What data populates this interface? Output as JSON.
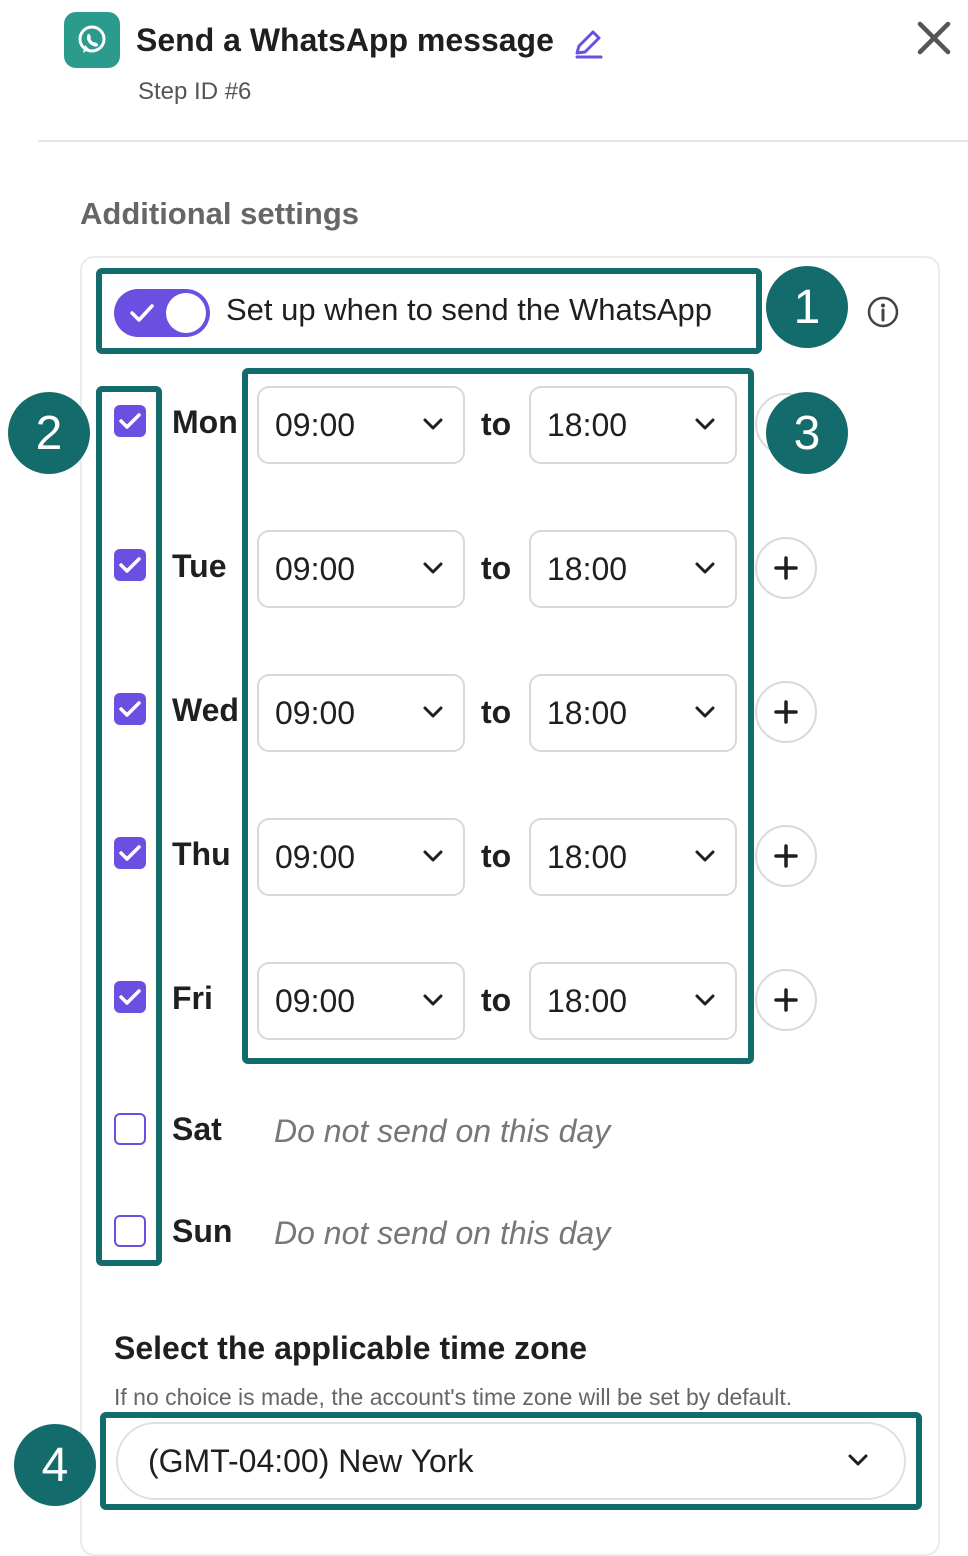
{
  "header": {
    "title": "Send a WhatsApp message",
    "step_id": "Step ID #6",
    "icons": {
      "app": "whatsapp-icon",
      "edit": "pencil-icon",
      "close": "close-icon"
    }
  },
  "section_title": "Additional settings",
  "toggle": {
    "label": "Set up when to send the WhatsApp",
    "enabled": true
  },
  "connector": "to",
  "days": [
    {
      "label": "Mon",
      "checked": true,
      "from": "09:00",
      "to": "18:00"
    },
    {
      "label": "Tue",
      "checked": true,
      "from": "09:00",
      "to": "18:00"
    },
    {
      "label": "Wed",
      "checked": true,
      "from": "09:00",
      "to": "18:00"
    },
    {
      "label": "Thu",
      "checked": true,
      "from": "09:00",
      "to": "18:00"
    },
    {
      "label": "Fri",
      "checked": true,
      "from": "09:00",
      "to": "18:00"
    },
    {
      "label": "Sat",
      "checked": false,
      "message": "Do not send on this day"
    },
    {
      "label": "Sun",
      "checked": false,
      "message": "Do not send on this day"
    }
  ],
  "timezone": {
    "title": "Select the applicable time zone",
    "help": "If no choice is made, the account's time zone will be set by default.",
    "value": "(GMT-04:00) New York"
  },
  "annotations": [
    "1",
    "2",
    "3",
    "4"
  ],
  "colors": {
    "accent": "#6b4fe0",
    "annotation": "#146b6b",
    "brand": "#2b9b8e"
  }
}
